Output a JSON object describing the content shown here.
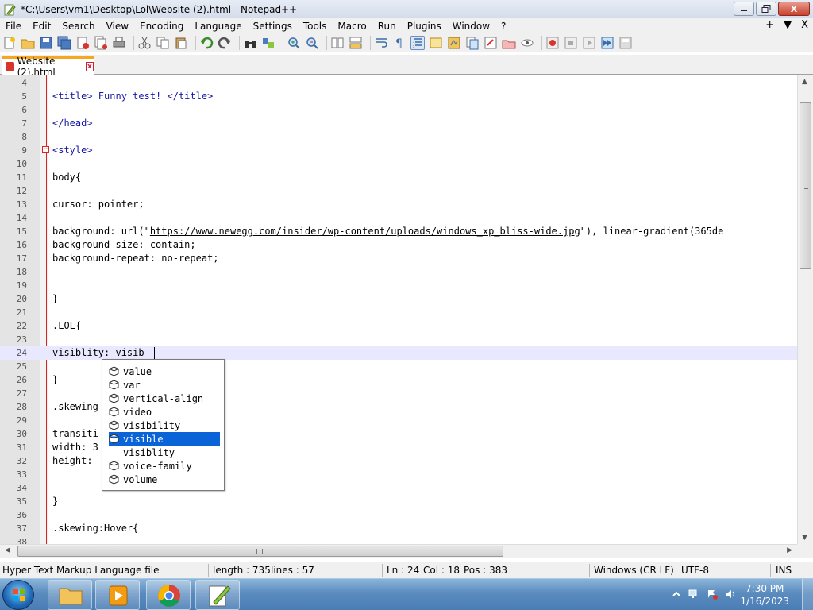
{
  "window": {
    "title": "*C:\\Users\\vm1\\Desktop\\Lol\\Website (2).html - Notepad++",
    "minimize_icon": "minimize-icon",
    "maximize_icon": "maximize-icon",
    "close_label": "X"
  },
  "menu": {
    "items": [
      "File",
      "Edit",
      "Search",
      "View",
      "Encoding",
      "Language",
      "Settings",
      "Tools",
      "Macro",
      "Run",
      "Plugins",
      "Window",
      "?"
    ],
    "right": [
      "+",
      "▼",
      "X"
    ]
  },
  "tab": {
    "label": "Website (2).html",
    "close_label": "x"
  },
  "editor": {
    "lines": [
      {
        "n": "4",
        "code": ""
      },
      {
        "n": "5",
        "code": "<title> Funny test! </title>"
      },
      {
        "n": "6",
        "code": ""
      },
      {
        "n": "7",
        "code": "</head>"
      },
      {
        "n": "8",
        "code": ""
      },
      {
        "n": "9",
        "code": "<style>"
      },
      {
        "n": "10",
        "code": ""
      },
      {
        "n": "11",
        "code": "body{"
      },
      {
        "n": "12",
        "code": ""
      },
      {
        "n": "13",
        "code": "cursor: pointer;"
      },
      {
        "n": "14",
        "code": ""
      },
      {
        "n": "15",
        "code": "background: url(\"https://www.newegg.com/insider/wp-content/uploads/windows_xp_bliss-wide.jpg\"), linear-gradient(365de"
      },
      {
        "n": "16",
        "code": "background-size: contain;"
      },
      {
        "n": "17",
        "code": "background-repeat: no-repeat;"
      },
      {
        "n": "18",
        "code": ""
      },
      {
        "n": "19",
        "code": ""
      },
      {
        "n": "20",
        "code": "}"
      },
      {
        "n": "21",
        "code": ""
      },
      {
        "n": "22",
        "code": ".LOL{"
      },
      {
        "n": "23",
        "code": ""
      },
      {
        "n": "24",
        "code": "visiblity: visib"
      },
      {
        "n": "25",
        "code": ""
      },
      {
        "n": "26",
        "code": "}"
      },
      {
        "n": "27",
        "code": ""
      },
      {
        "n": "28",
        "code": ".skewing"
      },
      {
        "n": "29",
        "code": ""
      },
      {
        "n": "30",
        "code": "transiti"
      },
      {
        "n": "31",
        "code": "width: 3"
      },
      {
        "n": "32",
        "code": "height:"
      },
      {
        "n": "33",
        "code": ""
      },
      {
        "n": "34",
        "code": ""
      },
      {
        "n": "35",
        "code": "}"
      },
      {
        "n": "36",
        "code": ""
      },
      {
        "n": "37",
        "code": ".skewing:Hover{"
      },
      {
        "n": "38",
        "code": ""
      }
    ],
    "line15_parts": {
      "prefix": "background: url(\"",
      "url": "https://www.newegg.com/insider/wp-content/uploads/windows_xp_bliss-wide.jpg",
      "suffix": "\"), linear-gradient(365de"
    },
    "current_line": "24"
  },
  "autocomplete": {
    "items": [
      {
        "label": "value",
        "icon": "cube-icon",
        "selected": false
      },
      {
        "label": "var",
        "icon": "cube-icon",
        "selected": false
      },
      {
        "label": "vertical-align",
        "icon": "cube-icon",
        "selected": false
      },
      {
        "label": "video",
        "icon": "cube-icon",
        "selected": false
      },
      {
        "label": "visibility",
        "icon": "cube-icon",
        "selected": false
      },
      {
        "label": "visible",
        "icon": "cube-icon",
        "selected": true
      },
      {
        "label": "visiblity",
        "icon": "",
        "selected": false
      },
      {
        "label": "voice-family",
        "icon": "cube-icon",
        "selected": false
      },
      {
        "label": "volume",
        "icon": "cube-icon",
        "selected": false
      }
    ]
  },
  "status": {
    "language": "Hyper Text Markup Language file",
    "length": "length : 735",
    "lines": "lines : 57",
    "ln": "Ln : 24",
    "col": "Col : 18",
    "pos": "Pos : 383",
    "eol": "Windows (CR LF)",
    "encoding": "UTF-8",
    "mode": "INS"
  },
  "taskbar": {
    "time": "7:30 PM",
    "date": "1/16/2023"
  },
  "colors": {
    "tag": "#1a1aa6",
    "selection": "#0a64d8",
    "current_line": "#e8e8ff",
    "tab_accent": "#f5a623"
  }
}
